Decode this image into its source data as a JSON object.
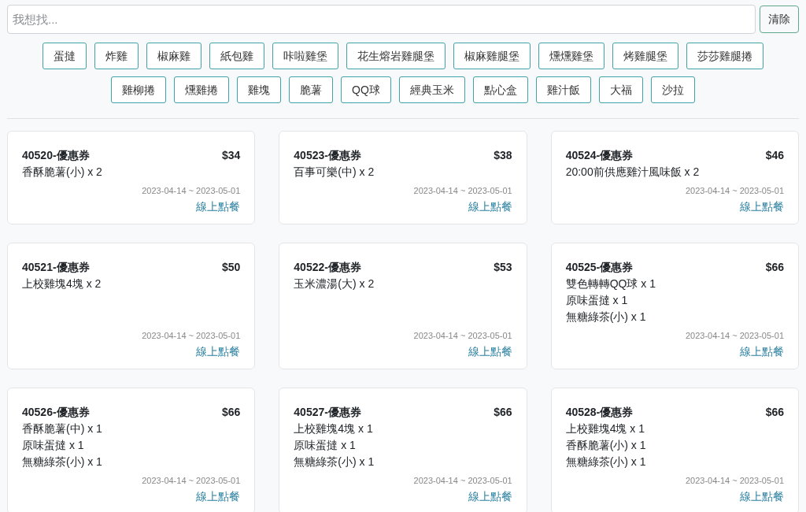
{
  "search": {
    "placeholder": "我想找...",
    "clear_button": "清除"
  },
  "tags": [
    "蛋撻",
    "炸雞",
    "椒麻雞",
    "紙包雞",
    "咔啦雞堡",
    "花生熔岩雞腿堡",
    "椒麻雞腿堡",
    "燻燻雞堡",
    "烤雞腿堡",
    "莎莎雞腿捲",
    "雞柳捲",
    "燻雞捲",
    "雞塊",
    "脆薯",
    "QQ球",
    "經典玉米",
    "點心盒",
    "雞汁飯",
    "大福",
    "沙拉"
  ],
  "coupons": [
    {
      "title": "40520-優惠券",
      "price": "$34",
      "items": [
        "香酥脆薯(小) x 2"
      ],
      "dates": "2023-04-14 ~ 2023-05-01",
      "link": "線上點餐"
    },
    {
      "title": "40523-優惠券",
      "price": "$38",
      "items": [
        "百事可樂(中) x 2"
      ],
      "dates": "2023-04-14 ~ 2023-05-01",
      "link": "線上點餐"
    },
    {
      "title": "40524-優惠券",
      "price": "$46",
      "items": [
        "20:00前供應雞汁風味飯 x 2"
      ],
      "dates": "2023-04-14 ~ 2023-05-01",
      "link": "線上點餐"
    },
    {
      "title": "40521-優惠券",
      "price": "$50",
      "items": [
        "上校雞塊4塊 x 2"
      ],
      "dates": "2023-04-14 ~ 2023-05-01",
      "link": "線上點餐"
    },
    {
      "title": "40522-優惠券",
      "price": "$53",
      "items": [
        "玉米濃湯(大) x 2"
      ],
      "dates": "2023-04-14 ~ 2023-05-01",
      "link": "線上點餐"
    },
    {
      "title": "40525-優惠券",
      "price": "$66",
      "items": [
        "雙色轉轉QQ球 x 1",
        "原味蛋撻 x 1",
        "無糖綠茶(小) x 1"
      ],
      "dates": "2023-04-14 ~ 2023-05-01",
      "link": "線上點餐"
    },
    {
      "title": "40526-優惠券",
      "price": "$66",
      "items": [
        "香酥脆薯(中) x 1",
        "原味蛋撻 x 1",
        "無糖綠茶(小) x 1"
      ],
      "dates": "2023-04-14 ~ 2023-05-01",
      "link": "線上點餐"
    },
    {
      "title": "40527-優惠券",
      "price": "$66",
      "items": [
        "上校雞塊4塊 x 1",
        "原味蛋撻 x 1",
        "無糖綠茶(小) x 1"
      ],
      "dates": "2023-04-14 ~ 2023-05-01",
      "link": "線上點餐"
    },
    {
      "title": "40528-優惠券",
      "price": "$66",
      "items": [
        "上校雞塊4塊 x 1",
        "香酥脆薯(小) x 1",
        "無糖綠茶(小) x 1"
      ],
      "dates": "2023-04-14 ~ 2023-05-01",
      "link": "線上點餐"
    }
  ]
}
